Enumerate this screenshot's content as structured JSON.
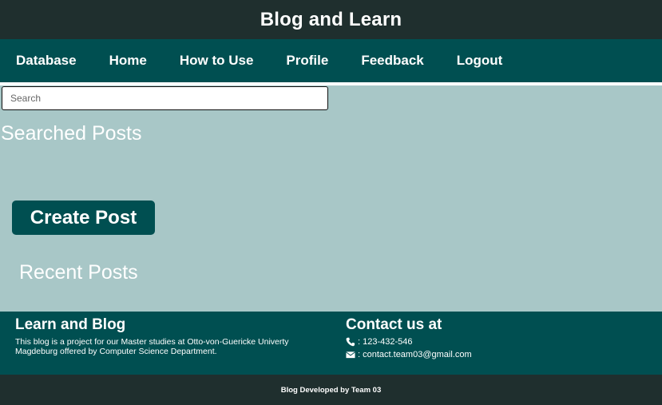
{
  "header": {
    "title": "Blog and Learn"
  },
  "nav": {
    "items": [
      "Database",
      "Home",
      "How to Use",
      "Profile",
      "Feedback",
      "Logout"
    ]
  },
  "search": {
    "placeholder": "Search",
    "value": ""
  },
  "main": {
    "searched_heading": "Searched Posts",
    "create_button_label": "Create Post",
    "recent_heading": "Recent Posts"
  },
  "footer": {
    "about_heading": "Learn and Blog",
    "about_text": "This blog is a project for our Master studies at Otto-von-Guericke Univerty Magdeburg offered by Computer Science Department.",
    "contact_heading": "Contact us at",
    "phone": ": 123-432-546",
    "email": ": contact.team03@gmail.com",
    "phone_icon": "phone-icon",
    "email_icon": "envelope-icon"
  },
  "credits": "Blog Developed by Team 03",
  "colors": {
    "top_bar": "#1f2f2e",
    "nav_bar": "#004f51",
    "main_bg": "#a8c7c7",
    "accent": "#004f51"
  }
}
